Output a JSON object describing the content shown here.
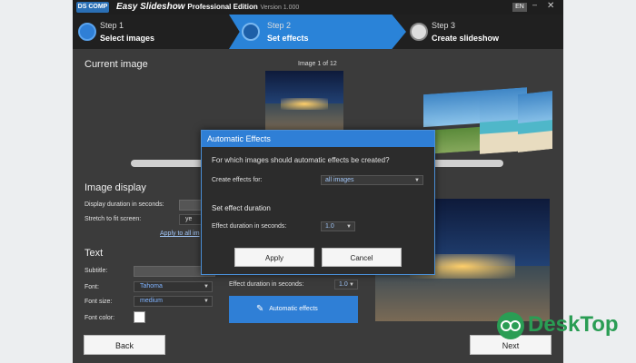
{
  "app": {
    "logo": "DS COMP",
    "title": "Easy Slideshow",
    "edition": "Professional Edition",
    "version": "Version 1.000",
    "lang": "EN"
  },
  "steps": [
    {
      "num": "Step 1",
      "label": "Select images"
    },
    {
      "num": "Step 2",
      "label": "Set effects"
    },
    {
      "num": "Step 3",
      "label": "Create slideshow"
    }
  ],
  "current_image": {
    "heading": "Current image",
    "counter": "Image 1 of 12"
  },
  "image_display": {
    "heading": "Image display",
    "duration_label": "Display duration in seconds:",
    "stretch_label": "Stretch to fit screen:",
    "stretch_value": "ye",
    "apply_all": "Apply to all im"
  },
  "text": {
    "heading": "Text",
    "subtitle_label": "Subtitle:",
    "font_label": "Font:",
    "font_value": "Tahoma",
    "size_label": "Font size:",
    "size_value": "medium",
    "color_label": "Font color:",
    "font_color": "#ffffff"
  },
  "effects": {
    "duration_label": "Effect duration in seconds:",
    "duration_value": "1.0",
    "auto_button": "Automatic effects"
  },
  "dialog": {
    "title": "Automatic Effects",
    "question": "For which images should automatic effects be created?",
    "create_label": "Create effects for:",
    "create_value": "all images",
    "section": "Set effect duration",
    "duration_label": "Effect duration in seconds:",
    "duration_value": "1.0",
    "apply": "Apply",
    "cancel": "Cancel"
  },
  "nav": {
    "back": "Back",
    "next": "Next"
  },
  "watermark": "DeskTop",
  "colors": {
    "accent": "#2f7fd6",
    "background": "#3b3b3b",
    "watermark": "#2a9d54"
  }
}
